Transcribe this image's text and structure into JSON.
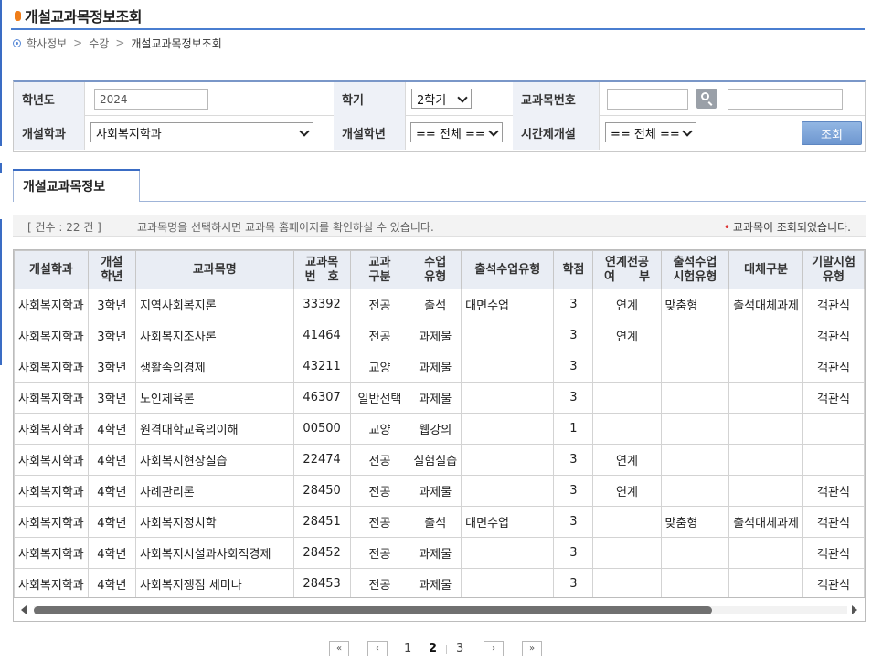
{
  "page": {
    "title": "개설교과목정보조회"
  },
  "breadcrumb": {
    "home": "학사정보",
    "mid": "수강",
    "current": "개설교과목정보조회",
    "sep1": ">",
    "sep2": ">"
  },
  "search": {
    "year_label": "학년도",
    "year_value": "2024",
    "semester_label": "학기",
    "semester_value": "2학기",
    "course_no_label": "교과목번호",
    "course_no_value": "",
    "course_name_value": "",
    "dept_label": "개설학과",
    "dept_value": "사회복지학과",
    "grade_label": "개설학년",
    "grade_value": "== 전체 ==",
    "time_label": "시간제개설",
    "time_value": "== 전체 ==",
    "query_button": "조회"
  },
  "tab": {
    "label": "개설교과목정보"
  },
  "info": {
    "count": "[ 건수 : 22 건 ]",
    "hint": "교과목명을 선택하시면 교과목 홈페이지를 확인하실 수 있습니다.",
    "message_dot": "•",
    "message": "교과목이 조회되었습니다."
  },
  "table": {
    "headers": [
      "개설학과",
      "개설\n학년",
      "교과목명",
      "교과목\n번　호",
      "교과\n구분",
      "수업\n유형",
      "출석수업유형",
      "학점",
      "연계전공\n여　　부",
      "출석수업\n시험유형",
      "대체구분",
      "기말시험\n유형"
    ],
    "rows": [
      [
        "사회복지학과",
        "3학년",
        "지역사회복지론",
        "33392",
        "전공",
        "출석",
        "대면수업",
        "3",
        "연계",
        "맞춤형",
        "출석대체과제",
        "객관식"
      ],
      [
        "사회복지학과",
        "3학년",
        "사회복지조사론",
        "41464",
        "전공",
        "과제물",
        "",
        "3",
        "연계",
        "",
        "",
        "객관식"
      ],
      [
        "사회복지학과",
        "3학년",
        "생활속의경제",
        "43211",
        "교양",
        "과제물",
        "",
        "3",
        "",
        "",
        "",
        "객관식"
      ],
      [
        "사회복지학과",
        "3학년",
        "노인체육론",
        "46307",
        "일반선택",
        "과제물",
        "",
        "3",
        "",
        "",
        "",
        "객관식"
      ],
      [
        "사회복지학과",
        "4학년",
        "원격대학교육의이해",
        "00500",
        "교양",
        "웹강의",
        "",
        "1",
        "",
        "",
        "",
        ""
      ],
      [
        "사회복지학과",
        "4학년",
        "사회복지현장실습",
        "22474",
        "전공",
        "실험실습",
        "",
        "3",
        "연계",
        "",
        "",
        ""
      ],
      [
        "사회복지학과",
        "4학년",
        "사례관리론",
        "28450",
        "전공",
        "과제물",
        "",
        "3",
        "연계",
        "",
        "",
        "객관식"
      ],
      [
        "사회복지학과",
        "4학년",
        "사회복지정치학",
        "28451",
        "전공",
        "출석",
        "대면수업",
        "3",
        "",
        "맞춤형",
        "출석대체과제",
        "객관식"
      ],
      [
        "사회복지학과",
        "4학년",
        "사회복지시설과사회적경제",
        "28452",
        "전공",
        "과제물",
        "",
        "3",
        "",
        "",
        "",
        "객관식"
      ],
      [
        "사회복지학과",
        "4학년",
        "사회복지쟁점 세미나",
        "28453",
        "전공",
        "과제물",
        "",
        "3",
        "",
        "",
        "",
        "객관식"
      ]
    ]
  },
  "pager": {
    "first": "«",
    "prev": "‹",
    "pages": [
      "1",
      "2",
      "3"
    ],
    "active": "2",
    "next": "›",
    "last": "»"
  },
  "scrollbar": {
    "position": 0
  },
  "colors": {
    "accent": "#3a6cc4",
    "header_bg": "#e9edf4",
    "bullet": "#ef7d1a"
  }
}
